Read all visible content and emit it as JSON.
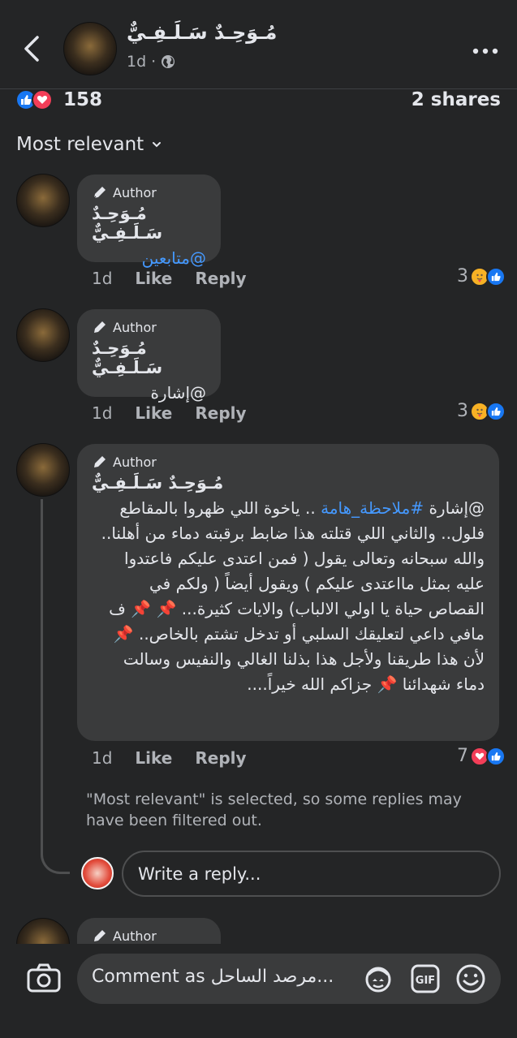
{
  "header": {
    "page_name": "مُـوَحِـدٌ سَـلَـفِـيٌّ",
    "time": "1d",
    "separator": "·"
  },
  "reactions": {
    "count": "158",
    "shares": "2 shares"
  },
  "sort_label": "Most relevant",
  "comments": [
    {
      "author_label": "Author",
      "name": "مُـوَحِـدٌ سَـلَـفِـيٌّ",
      "text": "@متابعين",
      "time": "1d",
      "like": "Like",
      "reply": "Reply",
      "reaction_count": "3"
    },
    {
      "author_label": "Author",
      "name": "مُـوَحِـدٌ سَـلَـفِـيٌّ",
      "text": "@إشارة",
      "time": "1d",
      "like": "Like",
      "reply": "Reply",
      "reaction_count": "3"
    },
    {
      "author_label": "Author",
      "name": "مُـوَحِـدٌ سَـلَـفِـيٌّ",
      "text_prefix": "@إشارة ",
      "hashtag": "#ملاحظة_هامة",
      "text_body": " .. ياخوة اللي ظهروا بالمقاطع فلول.. والثاني اللي قتلته هذا ضابط برقبته دماء من أهلنا.. والله سبحانه وتعالى يقول ( فمن اعتدى عليكم فاعتدوا عليه بمثل مااعتدى عليكم ) ويقول أيضاً ( ولكم في القصاص حياة يا اولي الالباب) والايات كثيرة... 📌 📌 ف مافي داعي لتعليقك السلبي أو تدخل تشتم بالخاص.. 📌 لأن هذا طريقنا ولأجل هذا بذلنا الغالي والنفيس وسالت دماء شهدائنا 📌 جزاكم الله خيراً....",
      "time": "1d",
      "like": "Like",
      "reply": "Reply",
      "reaction_count": "7"
    }
  ],
  "filter_notice": "\"Most relevant\" is selected, so some replies may have been filtered out.",
  "reply_placeholder": "Write a reply...",
  "partial_comment": {
    "author_label": "Author"
  },
  "composer": {
    "placeholder": "Comment as مرصد الساحل..."
  }
}
